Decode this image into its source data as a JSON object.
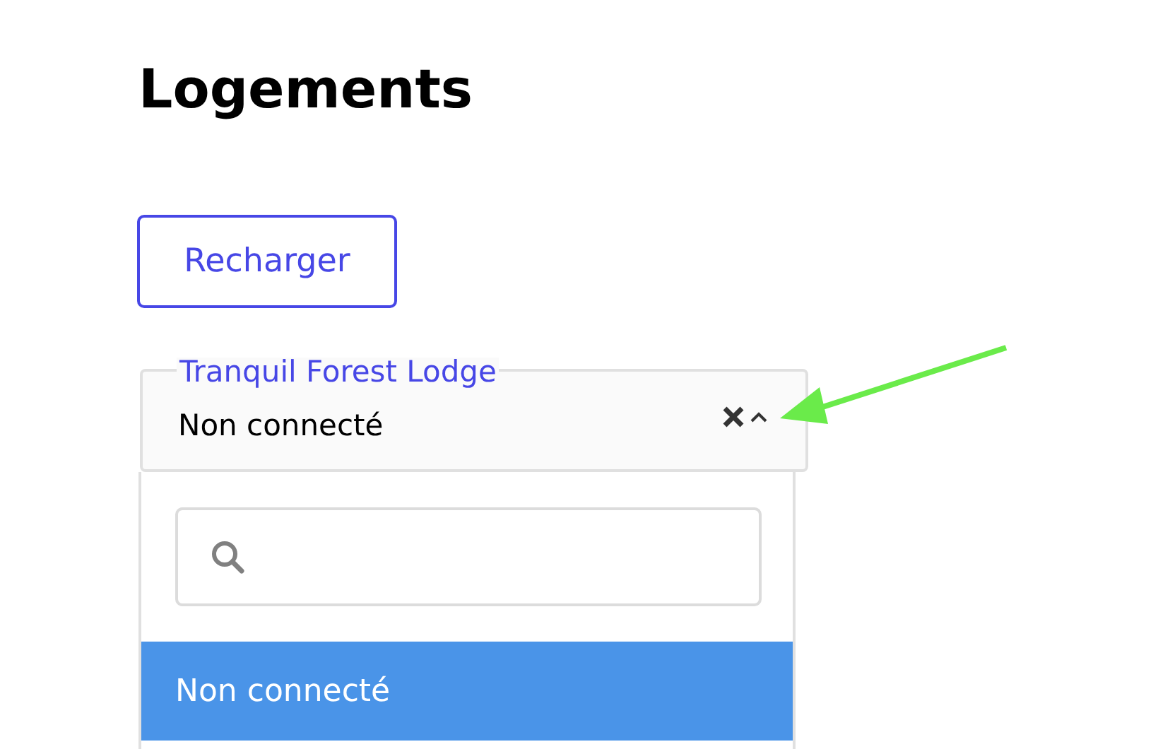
{
  "page": {
    "title": "Logements"
  },
  "reload_button": {
    "label": "Recharger"
  },
  "select": {
    "label": "Tranquil Forest Lodge",
    "value": "Non connecté",
    "expanded": true
  },
  "dropdown": {
    "options": [
      {
        "label": "Non connecté",
        "selected": true
      }
    ]
  }
}
